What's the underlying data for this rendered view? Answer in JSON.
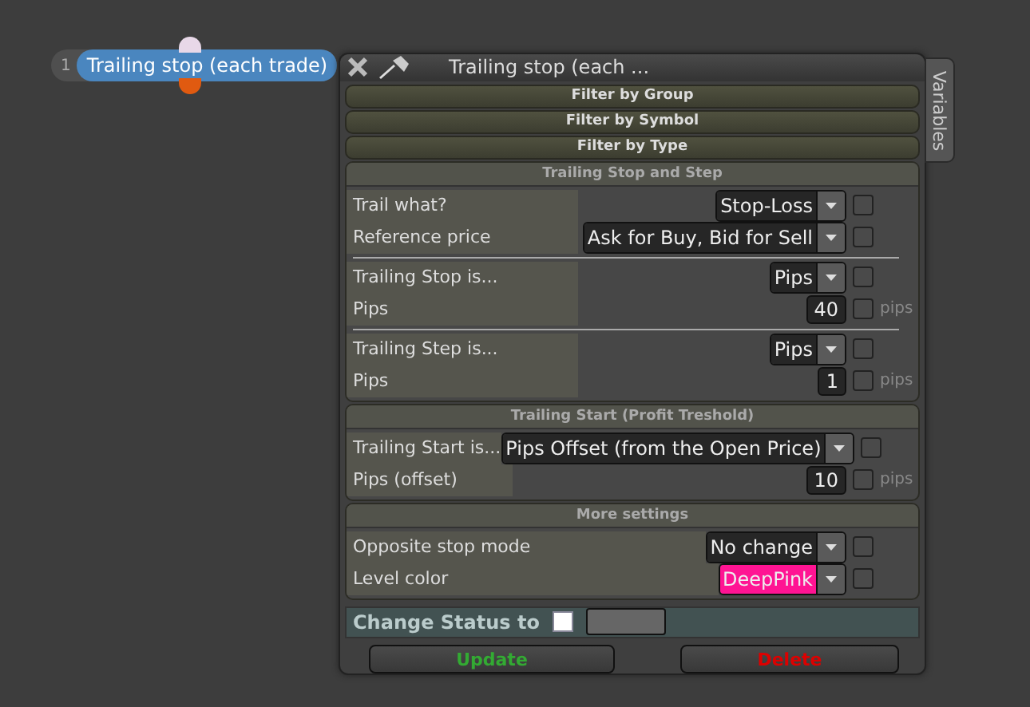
{
  "node": {
    "index": "1",
    "title": "Trailing stop (each trade)"
  },
  "panel": {
    "title": "Trailing stop (each ...",
    "side_tab": "Variables",
    "filters": [
      "Filter by Group",
      "Filter by Symbol",
      "Filter by Type"
    ],
    "sections": [
      {
        "title": "Trailing Stop and Step",
        "groups": [
          [
            {
              "kind": "select",
              "label": "Trail what?",
              "value": "Stop-Loss",
              "checked": false
            },
            {
              "kind": "select",
              "label": "Reference price",
              "value": "Ask for Buy, Bid for Sell",
              "checked": false
            }
          ],
          [
            {
              "kind": "select",
              "label": "Trailing Stop is...",
              "value": "Pips",
              "checked": false
            },
            {
              "kind": "number",
              "label": "Pips",
              "value": "40",
              "checked": false,
              "unit": "pips"
            }
          ],
          [
            {
              "kind": "select",
              "label": "Trailing Step is...",
              "value": "Pips",
              "checked": false
            },
            {
              "kind": "number",
              "label": "Pips",
              "value": "1",
              "checked": false,
              "unit": "pips"
            }
          ]
        ]
      },
      {
        "title": "Trailing Start (Profit Treshold)",
        "groups": [
          [
            {
              "kind": "select",
              "label": "Trailing Start is...",
              "value": "Pips Offset (from the Open Price)",
              "checked": false
            },
            {
              "kind": "number",
              "label": "Pips (offset)",
              "value": "10",
              "checked": false,
              "unit": "pips"
            }
          ]
        ]
      },
      {
        "title": "More settings",
        "groups": [
          [
            {
              "kind": "select",
              "label": "Opposite stop mode",
              "value": "No change",
              "checked": false
            },
            {
              "kind": "select",
              "label": "Level color",
              "value": "DeepPink",
              "checked": false,
              "color": "#ff1493"
            }
          ]
        ]
      }
    ],
    "status": {
      "label": "Change Status to",
      "checked": false
    },
    "buttons": [
      {
        "label": "Update",
        "kind": "update"
      },
      {
        "label": "Delete",
        "kind": "delete"
      }
    ]
  }
}
